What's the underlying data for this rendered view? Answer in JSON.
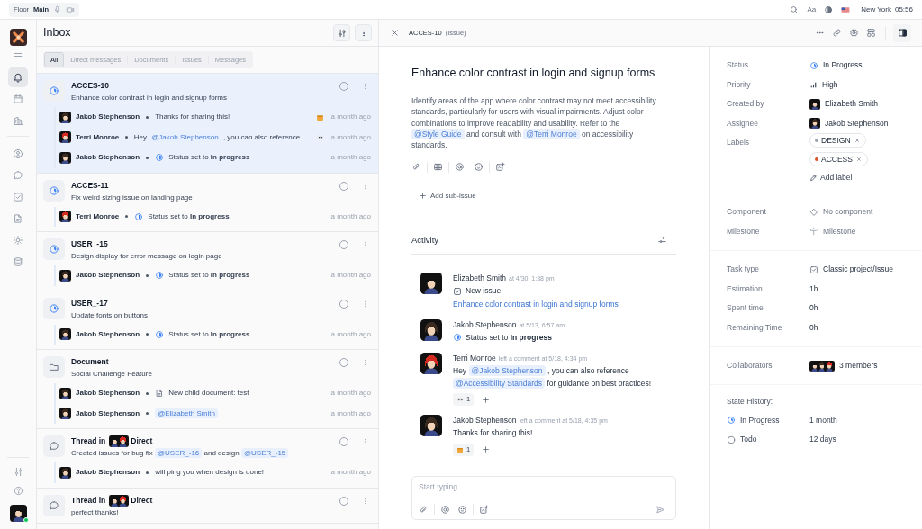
{
  "top_bar": {
    "workspace": "Floor",
    "room": "Main",
    "font_button": "Aa",
    "city": "New York",
    "time": "05:56"
  },
  "sidebar": {
    "items": [
      {
        "selected": true
      },
      {
        "selected": false
      },
      {
        "selected": false
      },
      {
        "selected": false
      },
      {
        "selected": false
      },
      {
        "selected": false
      },
      {
        "selected": false
      },
      {
        "selected": false
      },
      {
        "selected": false
      }
    ]
  },
  "inbox": {
    "title": "Inbox",
    "filters": [
      {
        "label": "All",
        "selected": true
      },
      {
        "label": "Direct messages",
        "selected": false
      },
      {
        "label": "Documents",
        "selected": false
      },
      {
        "label": "Issues",
        "selected": false
      },
      {
        "label": "Messages",
        "selected": false
      }
    ],
    "items": [
      {
        "kind": "issue",
        "title": "ACCES-10",
        "subtitle": [
          {
            "text": "Enhance color contrast in login and signup forms"
          }
        ],
        "selected": true,
        "entries": [
          {
            "author": "Jakob Stephenson",
            "color": "#3b2a20",
            "kind": "comment",
            "content": [
              {
                "text": "Thanks for sharing this!"
              }
            ],
            "reaction": {
              "kind": "box"
            },
            "time": "a month ago"
          },
          {
            "author": "Terri Monroe",
            "color": "#d42a1f",
            "kind": "comment",
            "content": [
              {
                "text": "Hey"
              },
              {
                "mention": "@Jakob Stephenson"
              },
              {
                "text": ", you can also reference ..."
              }
            ],
            "reaction": {
              "kind": "eyes"
            },
            "time": "a month ago"
          },
          {
            "author": "Jakob Stephenson",
            "color": "#3b2a20",
            "kind": "status",
            "content": [
              {
                "text": "Status set to **In progress**"
              }
            ],
            "time": "a month ago"
          }
        ]
      },
      {
        "kind": "issue",
        "title": "ACCES-11",
        "subtitle": [
          {
            "text": "Fix weird sizing issue on landing page"
          }
        ],
        "selected": false,
        "entries": [
          {
            "author": "Terri Monroe",
            "color": "#d42a1f",
            "kind": "status",
            "content": [
              {
                "text": "Status set to **In progress**"
              }
            ],
            "time": "a month ago"
          }
        ]
      },
      {
        "kind": "issue",
        "title": "USER_-15",
        "subtitle": [
          {
            "text": "Design display for error message on login page"
          }
        ],
        "selected": false,
        "entries": [
          {
            "author": "Jakob Stephenson",
            "color": "#3b2a20",
            "kind": "status",
            "content": [
              {
                "text": "Status set to **In progress**"
              }
            ],
            "time": "a month ago"
          }
        ]
      },
      {
        "kind": "issue",
        "title": "USER_-17",
        "subtitle": [
          {
            "text": "Update fonts on buttons"
          }
        ],
        "selected": false,
        "entries": [
          {
            "author": "Jakob Stephenson",
            "color": "#3b2a20",
            "kind": "status",
            "content": [
              {
                "text": "Status set to **In progress**"
              }
            ],
            "time": "a month ago"
          }
        ]
      },
      {
        "kind": "document",
        "title": "Document",
        "subtitle": [
          {
            "text": "Social Challenge Feature"
          }
        ],
        "selected": false,
        "entries": [
          {
            "author": "Jakob Stephenson",
            "color": "#3b2a20",
            "kind": "document",
            "content": [
              {
                "text": "New child document: test"
              }
            ],
            "time": "a month ago"
          },
          {
            "author": "Jakob Stephenson",
            "color": "#3b2a20",
            "kind": "comment",
            "content": [
              {
                "mention": "@Elizabeth Smith"
              }
            ],
            "time": "a month ago"
          }
        ]
      },
      {
        "kind": "thread",
        "title": "Thread in",
        "avatars": [
          {
            "color": "#111111"
          },
          {
            "color": "#d42a1f"
          }
        ],
        "channel": "Direct",
        "subtitle": [
          {
            "text": "Created issues for bug fix"
          },
          {
            "mention": "@USER_-16"
          },
          {
            "text": "and design"
          },
          {
            "mention": "@USER_-15"
          }
        ],
        "selected": false,
        "entries": [
          {
            "author": "Jakob Stephenson",
            "color": "#3b2a20",
            "kind": "comment",
            "content": [
              {
                "text": "will ping you when design is done!"
              }
            ],
            "time": "a month ago"
          }
        ]
      },
      {
        "kind": "thread",
        "title": "Thread in",
        "avatars": [
          {
            "color": "#111111"
          },
          {
            "color": "#d42a1f"
          }
        ],
        "channel": "Direct",
        "subtitle": [
          {
            "text": "perfect thanks!"
          }
        ],
        "selected": false
      }
    ]
  },
  "detail": {
    "id": "ACCES-10",
    "type": "(Issue)",
    "title": "Enhance color contrast in login and signup forms",
    "description": [
      {
        "text": "Identify areas of the app where color contrast may not meet accessibility standards, particularly for users with visual impairments. Adjust color combinations to improve readability and usability. Refer to the"
      },
      {
        "mention": "@Style Guide"
      },
      {
        "text": "and consult with"
      },
      {
        "mention": "@Terri Monroe"
      },
      {
        "text": "on accessibility standards."
      }
    ],
    "add_sub_issue": "Add sub-issue",
    "activity_title": "Activity",
    "activity": [
      {
        "author": "Elizabeth Smith",
        "color": "#111111",
        "meta": "at 4/30, 1:38 pm",
        "kind": "created",
        "content": [
          {
            "text": "New issue:"
          }
        ],
        "link": "Enhance color contrast in login and signup forms"
      },
      {
        "author": "Jakob Stephenson",
        "color": "#3b2a20",
        "meta": "at 5/13, 6:57 am",
        "kind": "status",
        "content": [
          {
            "text": "Status set to **In progress**"
          }
        ]
      },
      {
        "author": "Terri Monroe",
        "color": "#d42a1f",
        "meta": "left a comment at 5/18, 4:34 pm",
        "kind": "comment",
        "content": [
          {
            "text": "Hey"
          },
          {
            "mention": "@Jakob Stephenson"
          },
          {
            "text": ", you can also reference"
          },
          {
            "mention": "@Accessibility Standards"
          },
          {
            "text": "for guidance on best practices!"
          }
        ],
        "reactions": [
          {
            "kind": "eyes",
            "count": "1"
          }
        ]
      },
      {
        "author": "Jakob Stephenson",
        "color": "#3b2a20",
        "meta": "left a comment at 5/18, 4:35 pm",
        "kind": "comment",
        "content": [
          {
            "text": "Thanks for sharing this!"
          }
        ],
        "reactions": [
          {
            "kind": "box",
            "count": "1"
          }
        ]
      }
    ],
    "composer_placeholder": "Start typing..."
  },
  "properties": {
    "sections": [
      {
        "rows": [
          {
            "label": "Status",
            "kind": "status",
            "value": "In Progress"
          },
          {
            "label": "Priority",
            "kind": "priority",
            "value": "High"
          },
          {
            "label": "Created by",
            "kind": "person",
            "value": "Elizabeth Smith",
            "color": "#111111"
          },
          {
            "label": "Assignee",
            "kind": "person",
            "value": "Jakob Stephenson",
            "color": "#3b2a20"
          },
          {
            "label": "Labels",
            "kind": "labels",
            "labels": [
              {
                "text": "DESIGN",
                "color": "#9ca3af"
              },
              {
                "text": "ACCESS",
                "color": "#e0522d"
              }
            ],
            "add": "Add label"
          }
        ]
      },
      {
        "rows": [
          {
            "label": "Component",
            "kind": "component",
            "value": "No component"
          },
          {
            "label": "Milestone",
            "kind": "milestone",
            "value": "Milestone"
          }
        ]
      },
      {
        "rows": [
          {
            "label": "Task type",
            "kind": "tasktype",
            "value": "Classic project/Issue"
          },
          {
            "label": "Estimation",
            "kind": "plain",
            "value": "1h"
          },
          {
            "label": "Spent time",
            "kind": "plain",
            "value": "0h"
          },
          {
            "label": "Remaining Time",
            "kind": "plain",
            "value": "0h"
          }
        ]
      },
      {
        "rows": [
          {
            "label": "Collaborators",
            "kind": "members",
            "value": "3 members",
            "avatars": [
              {
                "color": "#111111"
              },
              {
                "color": "#3b2a20"
              },
              {
                "color": "#d42a1f"
              }
            ]
          }
        ]
      }
    ],
    "state_history": {
      "title": "State History:",
      "entries": [
        {
          "kind": "progress",
          "state": "In Progress",
          "duration": "1 month"
        },
        {
          "kind": "todo",
          "state": "Todo",
          "duration": "12 days"
        }
      ]
    }
  }
}
